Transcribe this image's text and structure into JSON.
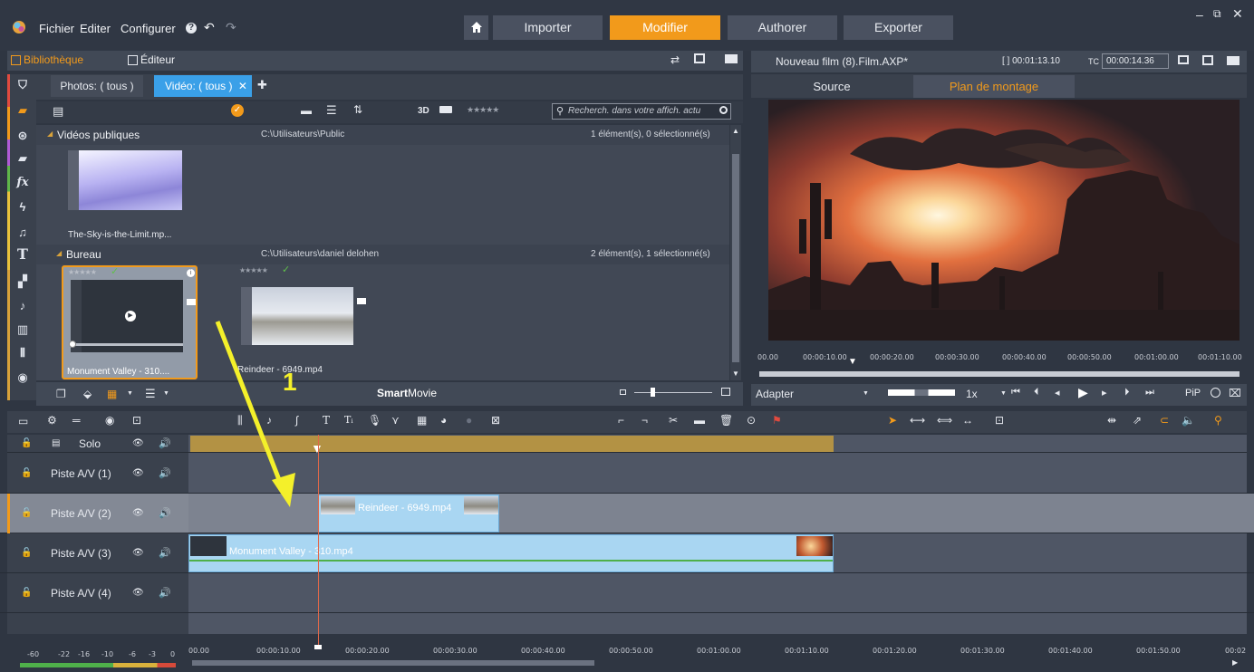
{
  "menu": {
    "file": "Fichier",
    "edit": "Editer",
    "configure": "Configurer"
  },
  "nav": {
    "import": "Importer",
    "edit": "Modifier",
    "author": "Authorer",
    "export": "Exporter"
  },
  "library": {
    "tab_library": "Bibliothèque",
    "tab_editor": "Éditeur",
    "filter_photos": "Photos: ( tous )",
    "filter_videos": "Vidéo: ( tous )",
    "label_3d": "3D",
    "rating_stars": "★★★★★",
    "search_placeholder": "Recherch. dans votre affich. actu",
    "groups": [
      {
        "name": "Vidéos publiques",
        "path": "C:\\Utilisateurs\\Public",
        "count": "1 élément(s), 0 sélectionné(s)"
      },
      {
        "name": "Bureau",
        "path": "C:\\Utilisateurs\\daniel delohen",
        "count": "2 élément(s), 1 sélectionné(s)"
      }
    ],
    "items": [
      {
        "label": "The-Sky-is-the-Limit.mp..."
      },
      {
        "label": "Monument Valley - 310...."
      },
      {
        "label": "Reindeer - 6949.mp4"
      }
    ],
    "smartmovie_bold": "Smart",
    "smartmovie_rest": "Movie"
  },
  "annotation": {
    "number": "1"
  },
  "preview": {
    "title": "Nouveau film (8).Film.AXP*",
    "duration": "[ ] 00:01:13.10",
    "tc_label": "TC",
    "tc_value": "00:00:14.36",
    "tab_source": "Source",
    "tab_timeline": "Plan de montage",
    "ruler": [
      "00.00",
      "00:00:10.00",
      "00:00:20.00",
      "00:00:30.00",
      "00:00:40.00",
      "00:00:50.00",
      "00:01:00.00",
      "00:01:10.00"
    ],
    "fit": "Adapter",
    "speed": "1x",
    "pip": "PiP"
  },
  "timeline": {
    "solo": "Solo",
    "tracks": [
      "Piste A/V (1)",
      "Piste A/V (2)",
      "Piste A/V (3)",
      "Piste A/V (4)"
    ],
    "clip_reindeer": "Reindeer - 6949.mp4",
    "clip_monument": "Monument Valley - 310.mp4",
    "ruler": [
      "00.00",
      "00:00:10.00",
      "00:00:20.00",
      "00:00:30.00",
      "00:00:40.00",
      "00:00:50.00",
      "00:01:00.00",
      "00:01:10.00",
      "00:01:20.00",
      "00:01:30.00",
      "00:01:40.00",
      "00:01:50.00",
      "00:02"
    ],
    "meter": [
      "-60",
      "-22",
      "-16",
      "-10",
      "-6",
      "-3",
      "0"
    ]
  },
  "colors": {
    "accent": "#f29a1b",
    "selected_tab": "#3aa0e8",
    "clip": "#a9d6f2",
    "audio_track": "#b39244"
  }
}
